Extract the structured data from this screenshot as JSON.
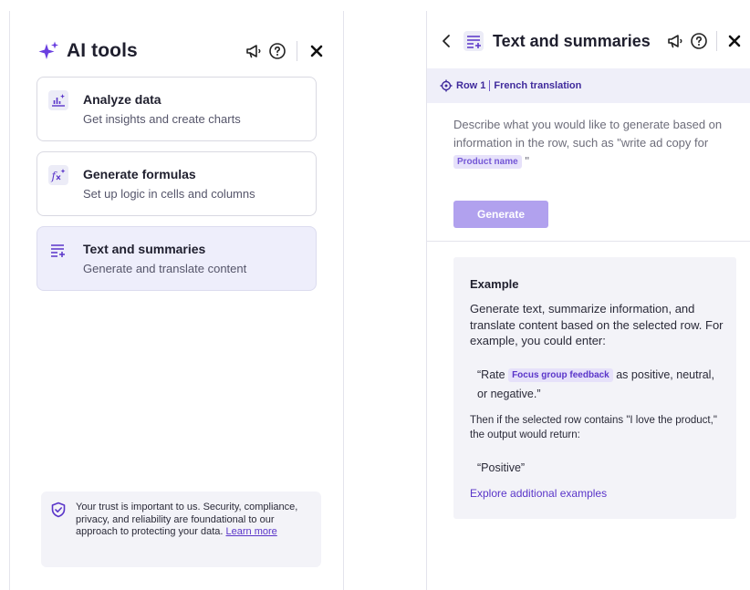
{
  "left_panel": {
    "title": "AI tools",
    "tools": [
      {
        "title": "Analyze data",
        "description": "Get insights and create charts",
        "icon": "chart-sparkle-icon"
      },
      {
        "title": "Generate formulas",
        "description": "Set up logic in cells and columns",
        "icon": "formula-icon"
      },
      {
        "title": "Text and summaries",
        "description": "Generate and translate content",
        "icon": "text-lines-icon",
        "active": true
      }
    ],
    "trust": {
      "text": "Your trust is important to us. Security, compliance, privacy, and reliability are foundational to our approach to protecting your data.",
      "link": "Learn more"
    }
  },
  "right_panel": {
    "title": "Text and summaries",
    "row_label": "Row 1",
    "column_label": "French translation",
    "prompt_text": "Describe what you would like to generate based on information in the row, such as \"write ad copy for",
    "prompt_chip": "Product name",
    "prompt_end": "\"",
    "generate_label": "Generate",
    "example": {
      "title": "Example",
      "body": "Generate text, summarize information, and translate content based on the selected row. For example, you could enter:",
      "quote_start": "“Rate",
      "quote_chip": "Focus group feedback",
      "quote_end": "as positive, neutral, or negative.”",
      "then": "Then if the selected row contains \"I love the product,\" the output would return:",
      "output": "“Positive”",
      "link": "Explore additional examples"
    }
  },
  "colors": {
    "accent": "#5a35c9",
    "generate_button": "#b1a1ee",
    "active_card_bg": "#eeeefb",
    "row_bar_bg": "#efeff9",
    "example_bg": "#f3f3f8"
  },
  "icons": {
    "header_left": [
      "sparkle-icon",
      "megaphone-icon",
      "help-icon",
      "close-icon"
    ],
    "header_right": [
      "back-chevron-icon",
      "text-lines-icon",
      "megaphone-icon",
      "help-icon",
      "close-icon"
    ],
    "trust": "shield-check-icon",
    "row": "target-icon"
  }
}
